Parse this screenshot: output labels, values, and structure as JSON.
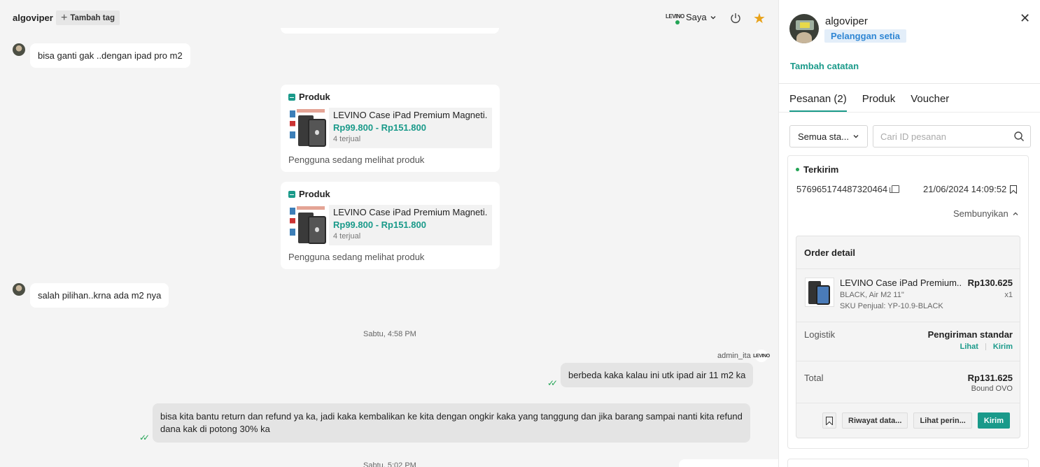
{
  "header": {
    "user_name": "algoviper",
    "add_tag_label": "Tambah tag",
    "brand_logo_text": "LEVINO",
    "assignee_label": "Saya"
  },
  "messages": {
    "m1": "bisa ganti gak ..dengan ipad pro m2",
    "product_cards": [
      {
        "header_label": "Produk",
        "title": "LEVINO Case iPad Premium Magneti...",
        "price": "Rp99.800 - Rp151.800",
        "sold": "4 terjual",
        "footer": "Pengguna sedang melihat produk"
      },
      {
        "header_label": "Produk",
        "title": "LEVINO Case iPad Premium Magneti...",
        "price": "Rp99.800 - Rp151.800",
        "sold": "4 terjual",
        "footer": "Pengguna sedang melihat produk"
      }
    ],
    "m2": "salah pilihan..krna ada m2 nya",
    "time1": "Sabtu, 4:58 PM",
    "sender": "admin_ita",
    "m3": "berbeda kaka kalau ini utk ipad air 11 m2 ka",
    "m4_line1": "bisa kita bantu return dan refund ya ka, jadi kaka kembalikan ke kita dengan ongkir kaka yang tanggung dan jika barang sampai nanti kita refund",
    "m4_line2": "dana kak di potong 30% ka",
    "time2": "Sabtu, 5:02 PM"
  },
  "panel": {
    "name": "algoviper",
    "badge": "Pelanggan setia",
    "add_note": "Tambah catatan",
    "tabs": [
      {
        "label": "Pesanan (2)",
        "active": true
      },
      {
        "label": "Produk",
        "active": false
      },
      {
        "label": "Voucher",
        "active": false
      }
    ],
    "status_filter": "Semua sta...",
    "search_placeholder": "Cari ID pesanan",
    "order": {
      "status": "Terkirim",
      "id": "576965174487320464",
      "date": "21/06/2024 14:09:52",
      "hide_label": "Sembunyikan",
      "detail_title": "Order detail",
      "product_name": "LEVINO Case iPad Premium...",
      "variant": "BLACK, Air M2 11\"",
      "sku": "SKU Penjual: YP-10.9-BLACK",
      "price": "Rp130.625",
      "qty": "x1",
      "logistics_label": "Logistik",
      "logistics_value": "Pengiriman standar",
      "link_view": "Lihat",
      "link_send": "Kirim",
      "total_label": "Total",
      "total_value": "Rp131.625",
      "payment": "Bound OVO",
      "btn_history": "Riwayat data...",
      "btn_details": "Lihat perin...",
      "btn_send": "Kirim"
    }
  },
  "colors": {
    "accent": "#1a9a8a",
    "online": "#23a455",
    "star": "#e8a21a",
    "badge_text": "#2f86d4"
  }
}
